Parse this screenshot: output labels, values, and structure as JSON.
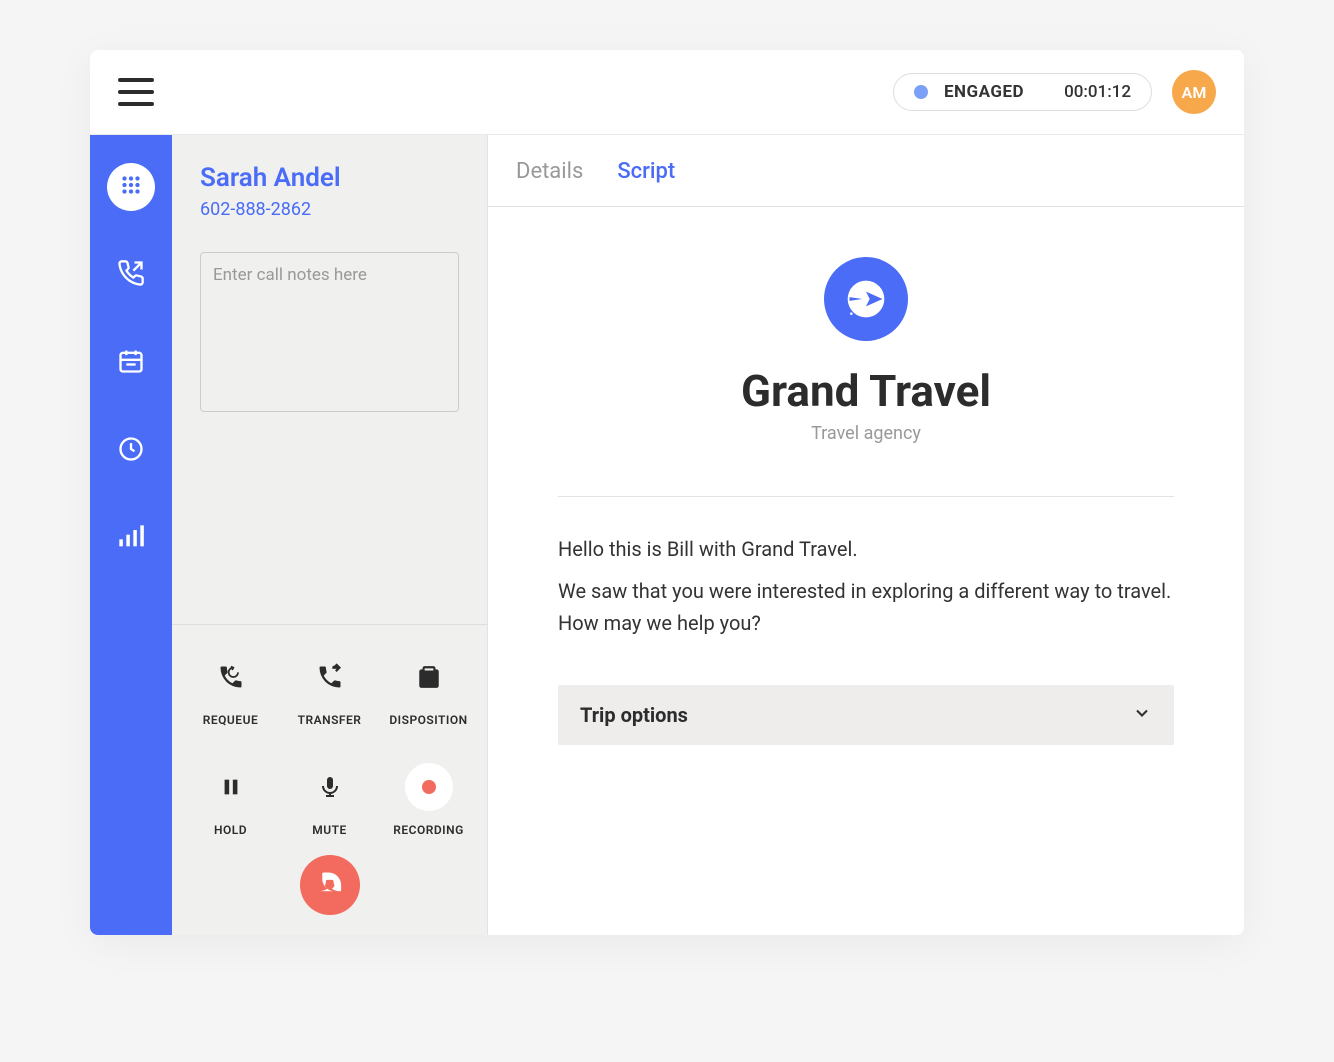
{
  "header": {
    "status_label": "ENGAGED",
    "status_time": "00:01:12",
    "avatar_initials": "AM"
  },
  "caller": {
    "name": "Sarah Andel",
    "phone": "602-888-2862",
    "notes_placeholder": "Enter call notes here"
  },
  "controls": {
    "requeue": "REQUEUE",
    "transfer": "TRANSFER",
    "disposition": "DISPOSITION",
    "hold": "HOLD",
    "mute": "MUTE",
    "recording": "RECORDING"
  },
  "tabs": {
    "details": "Details",
    "script": "Script"
  },
  "script": {
    "brand_name": "Grand Travel",
    "brand_sub": "Travel agency",
    "line1": "Hello this is Bill with Grand Travel.",
    "line2": "We saw that you were interested in exploring a different way to travel. How may we help you?",
    "dropdown_label": "Trip options"
  },
  "colors": {
    "accent": "#4a6cf7",
    "hangup": "#f26b5e",
    "avatar_bg": "#f7a84b"
  }
}
